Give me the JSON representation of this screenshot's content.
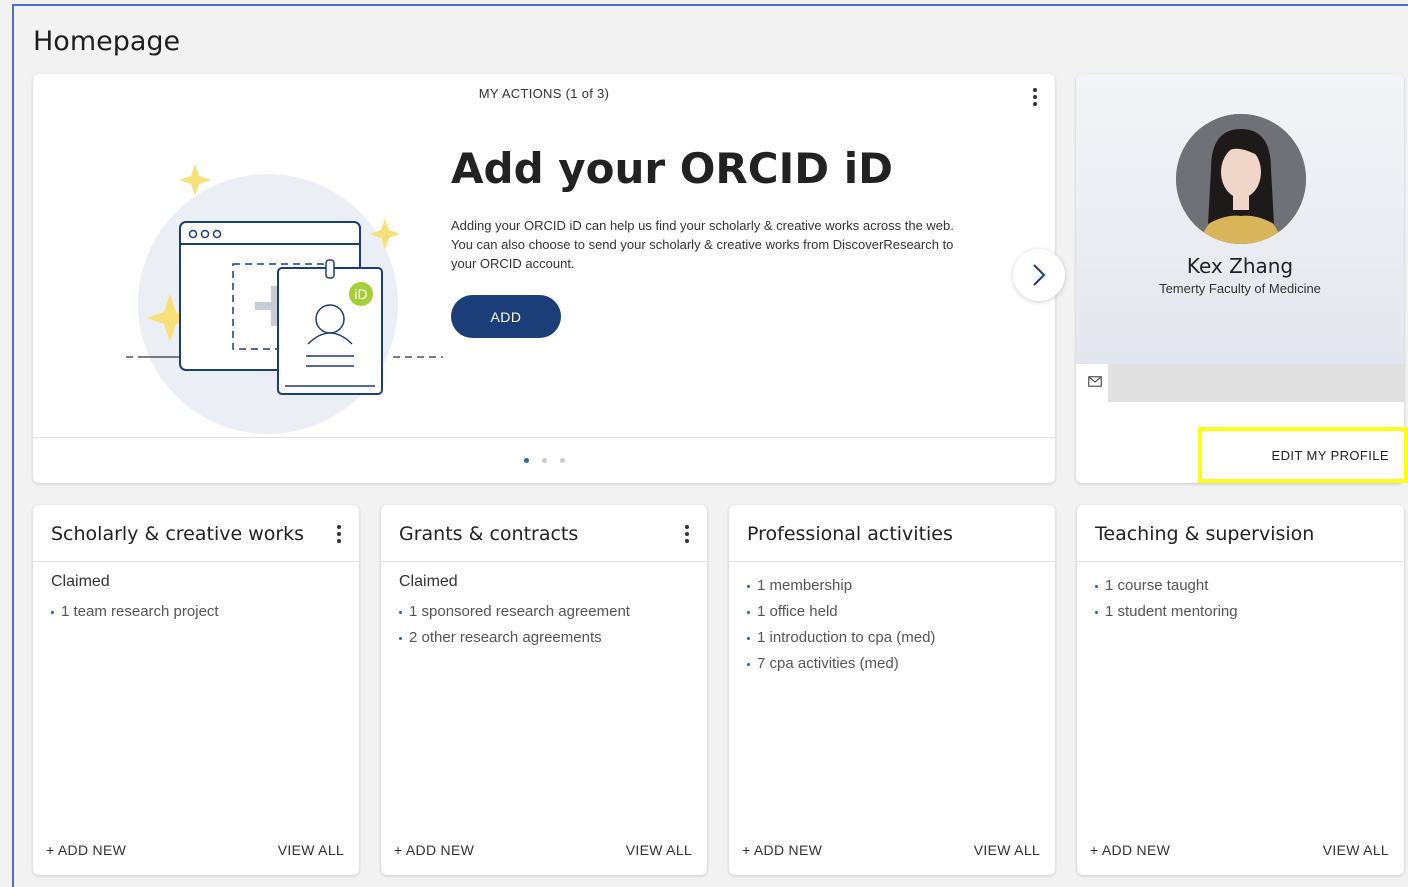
{
  "page": {
    "title": "Homepage"
  },
  "actions": {
    "header": "MY ACTIONS (1 of 3)",
    "title": "Add your ORCID iD",
    "description": "Adding your ORCID iD can help us find your scholarly & creative works across the web. You can also choose to send your scholarly & creative works from DiscoverResearch to your ORCID account.",
    "add_label": "ADD",
    "orcid_badge": "iD",
    "accent_color": "#1b3d78"
  },
  "profile": {
    "name": "Kex Zhang",
    "department": "Temerty Faculty of Medicine",
    "edit_label": "EDIT MY PROFILE"
  },
  "cards": [
    {
      "title": "Scholarly & creative works",
      "subtitle": "Claimed",
      "items": [
        "1 team research project"
      ],
      "add_label": "+ ADD NEW",
      "view_label": "VIEW ALL"
    },
    {
      "title": "Grants & contracts",
      "subtitle": "Claimed",
      "items": [
        "1 sponsored research agreement",
        "2 other research agreements"
      ],
      "add_label": "+ ADD NEW",
      "view_label": "VIEW ALL"
    },
    {
      "title": "Professional activities",
      "items": [
        "1 membership",
        "1 office held",
        "1 introduction to cpa (med)",
        "7 cpa activities (med)"
      ],
      "add_label": "+ ADD NEW",
      "view_label": "VIEW ALL"
    },
    {
      "title": "Teaching & supervision",
      "items": [
        "1 course taught",
        "1 student mentoring"
      ],
      "add_label": "+ ADD NEW",
      "view_label": "VIEW ALL"
    }
  ]
}
